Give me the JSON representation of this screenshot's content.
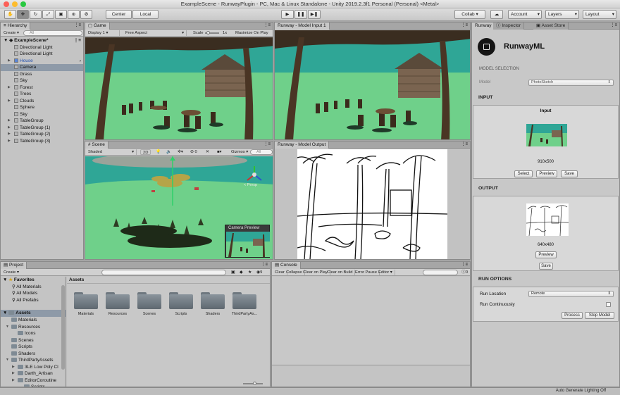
{
  "window": {
    "title": "ExampleScene - RunwayPlugin - PC, Mac & Linux Standalone - Unity 2019.2.3f1 Personal (Personal) <Metal>"
  },
  "toolbar": {
    "tools": [
      "hand-icon",
      "move-icon",
      "rotate-icon",
      "scale-icon",
      "rect-icon",
      "transform-icon",
      "custom-icon"
    ],
    "center": "Center",
    "local": "Local",
    "collab": "Collab ▾",
    "account": "Account",
    "layers": "Layers",
    "layout": "Layout"
  },
  "hierarchy": {
    "tab": "Hierarchy",
    "create": "Create ▾",
    "search_placeholder": "All",
    "scene": "ExampleScene*",
    "items": [
      {
        "label": "Directional Light",
        "indent": 1,
        "expand": false,
        "color": "#111"
      },
      {
        "label": "Directional Light",
        "indent": 1,
        "expand": false,
        "color": "#111"
      },
      {
        "label": "House",
        "indent": 1,
        "expand": true,
        "color": "#1f4fb0"
      },
      {
        "label": "Camera",
        "indent": 1,
        "expand": false,
        "color": "#111",
        "selected": true
      },
      {
        "label": "Grass",
        "indent": 1,
        "expand": false,
        "color": "#111"
      },
      {
        "label": "Sky",
        "indent": 1,
        "expand": false,
        "color": "#111"
      },
      {
        "label": "Forest",
        "indent": 1,
        "expand": true,
        "color": "#111"
      },
      {
        "label": "Trees",
        "indent": 1,
        "expand": false,
        "color": "#111"
      },
      {
        "label": "Clouds",
        "indent": 1,
        "expand": true,
        "color": "#111"
      },
      {
        "label": "Sphere",
        "indent": 1,
        "expand": false,
        "color": "#111"
      },
      {
        "label": "Sky",
        "indent": 1,
        "expand": false,
        "color": "#111"
      },
      {
        "label": "TableGroup",
        "indent": 1,
        "expand": true,
        "color": "#111"
      },
      {
        "label": "TableGroup (1)",
        "indent": 1,
        "expand": true,
        "color": "#111"
      },
      {
        "label": "TableGroup (2)",
        "indent": 1,
        "expand": true,
        "color": "#111"
      },
      {
        "label": "TableGroup (3)",
        "indent": 1,
        "expand": true,
        "color": "#111"
      }
    ]
  },
  "game": {
    "tab": "Game",
    "display": "Display 1",
    "aspect": "Free Aspect",
    "scale_label": "Scale",
    "scale_value": "1x",
    "maximize": "Maximize On Play"
  },
  "scene": {
    "tab": "Scene",
    "shading": "Shaded",
    "mode2d": "2D",
    "gizmos": "Gizmos ▾",
    "search_placeholder": "All",
    "persp": "< Persp",
    "camera_preview": "Camera Preview",
    "counter": "0"
  },
  "runway_input": {
    "tab": "Runway - Model Input 1"
  },
  "runway_output": {
    "tab": "Runway - Model Output"
  },
  "project": {
    "tab": "Project",
    "create": "Create ▾",
    "favorites": "Favorites",
    "fav_items": [
      "All Materials",
      "All Models",
      "All Prefabs"
    ],
    "assets_root": "Assets",
    "tree": [
      {
        "label": "Materials",
        "indent": 1,
        "expand": false
      },
      {
        "label": "Resources",
        "indent": 1,
        "expand": true
      },
      {
        "label": "Icons",
        "indent": 2,
        "expand": false
      },
      {
        "label": "Scenes",
        "indent": 1,
        "expand": false
      },
      {
        "label": "Scripts",
        "indent": 1,
        "expand": false
      },
      {
        "label": "Shaders",
        "indent": 1,
        "expand": false
      },
      {
        "label": "ThirdPartyAssets",
        "indent": 1,
        "expand": true
      },
      {
        "label": "3LE Low Poly Cl",
        "indent": 2,
        "expand": true
      },
      {
        "label": "Darth_Artisan",
        "indent": 2,
        "expand": true
      },
      {
        "label": "EditorCoroutine",
        "indent": 2,
        "expand": true
      },
      {
        "label": "Scripts",
        "indent": 3,
        "expand": false
      }
    ],
    "breadcrumb": "Assets",
    "folders": [
      "Materials",
      "Resources",
      "Scenes",
      "Scripts",
      "Shaders",
      "ThirdPartyAs..."
    ],
    "badge": "9"
  },
  "console": {
    "tab": "Console",
    "buttons": [
      "Clear",
      "Collapse",
      "Clear on Play",
      "Clear on Build",
      "Error Pause",
      "Editor ▾"
    ],
    "count": "0"
  },
  "runway": {
    "tabs": [
      "Runway",
      "Inspector",
      "Asset Store"
    ],
    "brand": "RunwayML",
    "model_selection": "MODEL SELECTION",
    "model_label": "Model",
    "model_value": "PhotoSketch",
    "input_header": "INPUT",
    "input_title": "Input",
    "input_size": "910x500",
    "input_buttons": [
      "Select",
      "Preview",
      "Save"
    ],
    "output_header": "OUTPUT",
    "output_size": "640x480",
    "output_preview": "Preview",
    "output_save": "Save",
    "run_options": "RUN OPTIONS",
    "run_location_label": "Run Location",
    "run_location_value": "Remote",
    "run_continuously_label": "Run Continuously",
    "process": "Process",
    "stop": "Stop Model"
  },
  "status": {
    "right": "Auto Generate Lighting Off"
  },
  "colors": {
    "sky": "#2fa696",
    "ground": "#6fd08a",
    "selection": "#8e9aa8",
    "brand_dark": "#151515"
  }
}
